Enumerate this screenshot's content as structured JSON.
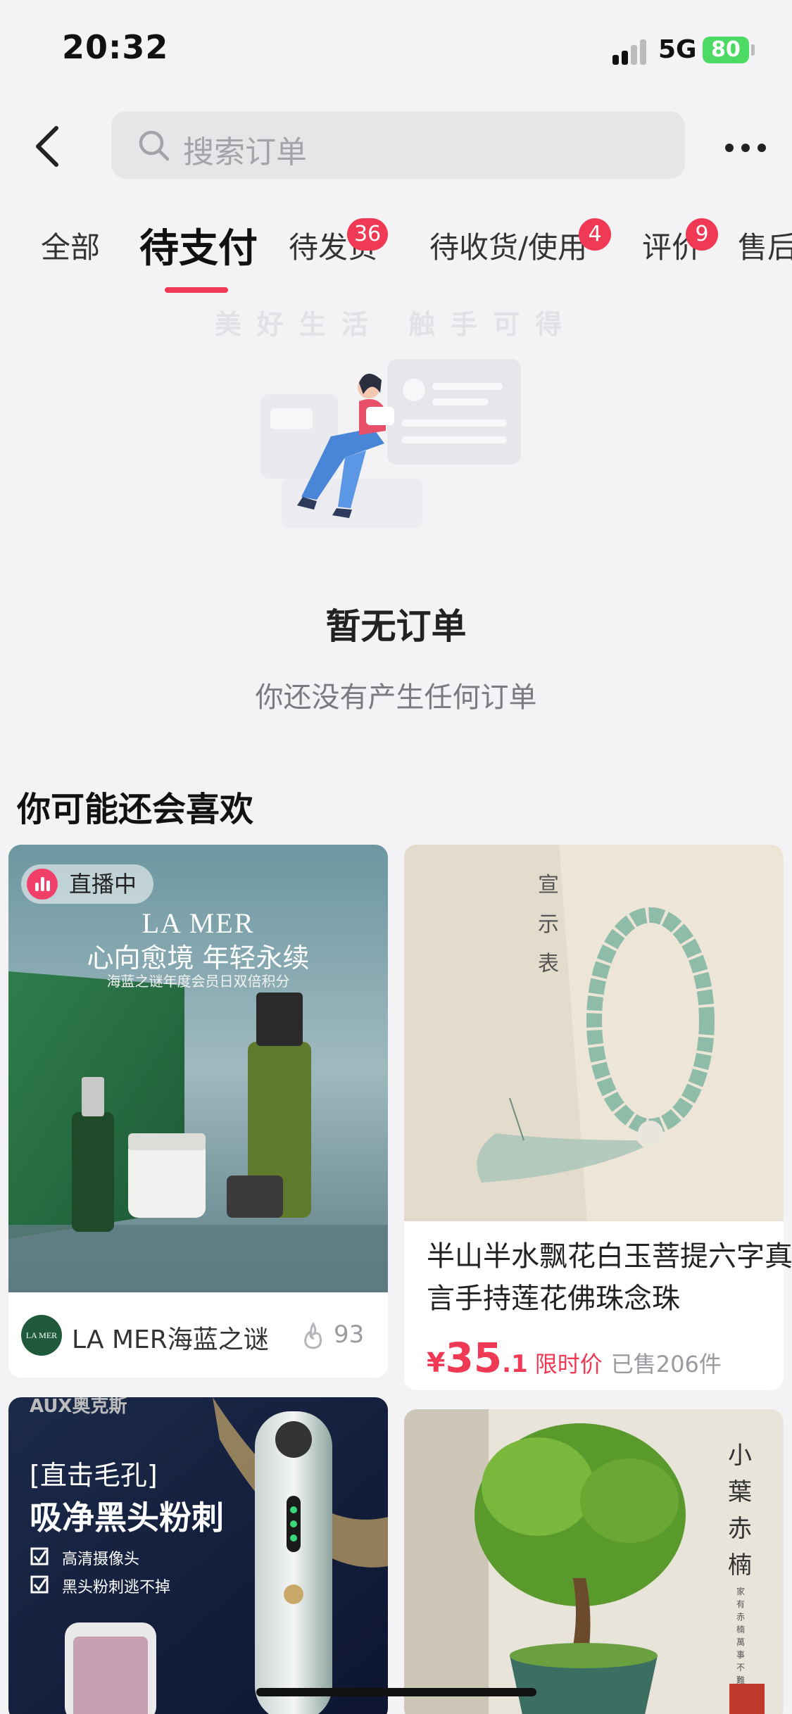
{
  "status_bar": {
    "time": "20:32",
    "network": "5G",
    "battery": "80"
  },
  "search": {
    "placeholder": "搜索订单"
  },
  "tabs": [
    {
      "label": "全部",
      "badge": ""
    },
    {
      "label": "待支付",
      "badge": ""
    },
    {
      "label": "待发货",
      "badge": "36"
    },
    {
      "label": "待收货/使用",
      "badge": "4"
    },
    {
      "label": "评价",
      "badge": "9"
    },
    {
      "label": "售后",
      "badge": ""
    }
  ],
  "empty_state": {
    "slogan": "美好生活 触手可得",
    "title": "暂无订单",
    "subtitle": "你还没有产生任何订单"
  },
  "recommend": {
    "title": "你可能还会喜欢",
    "cards": [
      {
        "live_label": "直播中",
        "brand": "LA MER",
        "image_headline": "心向愈境 年轻永续",
        "image_subline": "海蓝之谜年度会员日双倍积分",
        "shop_logo": "LA MER",
        "shop_name": "LA MER海蓝之谜",
        "likes": "93"
      },
      {
        "title": "半山半水飘花白玉菩提六字真言手持莲花佛珠念珠",
        "price_symbol": "¥",
        "price_int": "35",
        "price_dec": ".1",
        "price_tag": "限时价",
        "sold": "已售206件",
        "calligraphy": "宣示表"
      },
      {
        "brand": "AUX奥克斯",
        "bracket": "[直击毛孔]",
        "headline": "吸净黑头粉刺",
        "features": [
          "高清摄像头",
          "黑头粉刺逃不掉"
        ]
      },
      {
        "calligraphy": "小葉赤楠",
        "seal_text": "家有赤楠 萬事不難"
      }
    ]
  }
}
